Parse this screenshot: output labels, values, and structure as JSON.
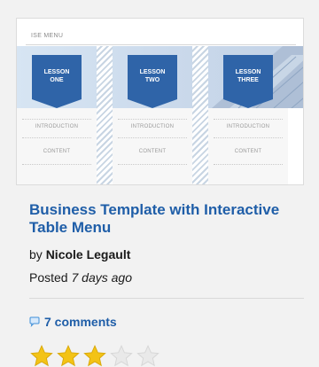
{
  "thumbnail": {
    "menu_heading": "ISE MENU",
    "lessons": [
      {
        "label_line1": "LESSON",
        "label_line2": "ONE",
        "row1": "INTRODUCTION",
        "row2": "CONTENT"
      },
      {
        "label_line1": "LESSON",
        "label_line2": "TWO",
        "row1": "INTRODUCTION",
        "row2": "CONTENT"
      },
      {
        "label_line1": "LESSON",
        "label_line2": "THREE",
        "row1": "INTRODUCTION",
        "row2": "CONTENT"
      }
    ]
  },
  "post": {
    "title": "Business Template with Interactive Table Menu",
    "by_prefix": "by",
    "author": "Nicole Legault",
    "posted_prefix": "Posted",
    "posted_ago": "7 days ago",
    "comments_label": "7 comments"
  },
  "rating": {
    "value": 3,
    "max": 5,
    "filled_color": "#f3c316",
    "empty_color": "#e9e9e9"
  },
  "colors": {
    "link": "#1f5ea8",
    "flag": "#2f64a8"
  },
  "icons": {
    "comments": "speech-bubble-icon",
    "star": "star-icon"
  }
}
